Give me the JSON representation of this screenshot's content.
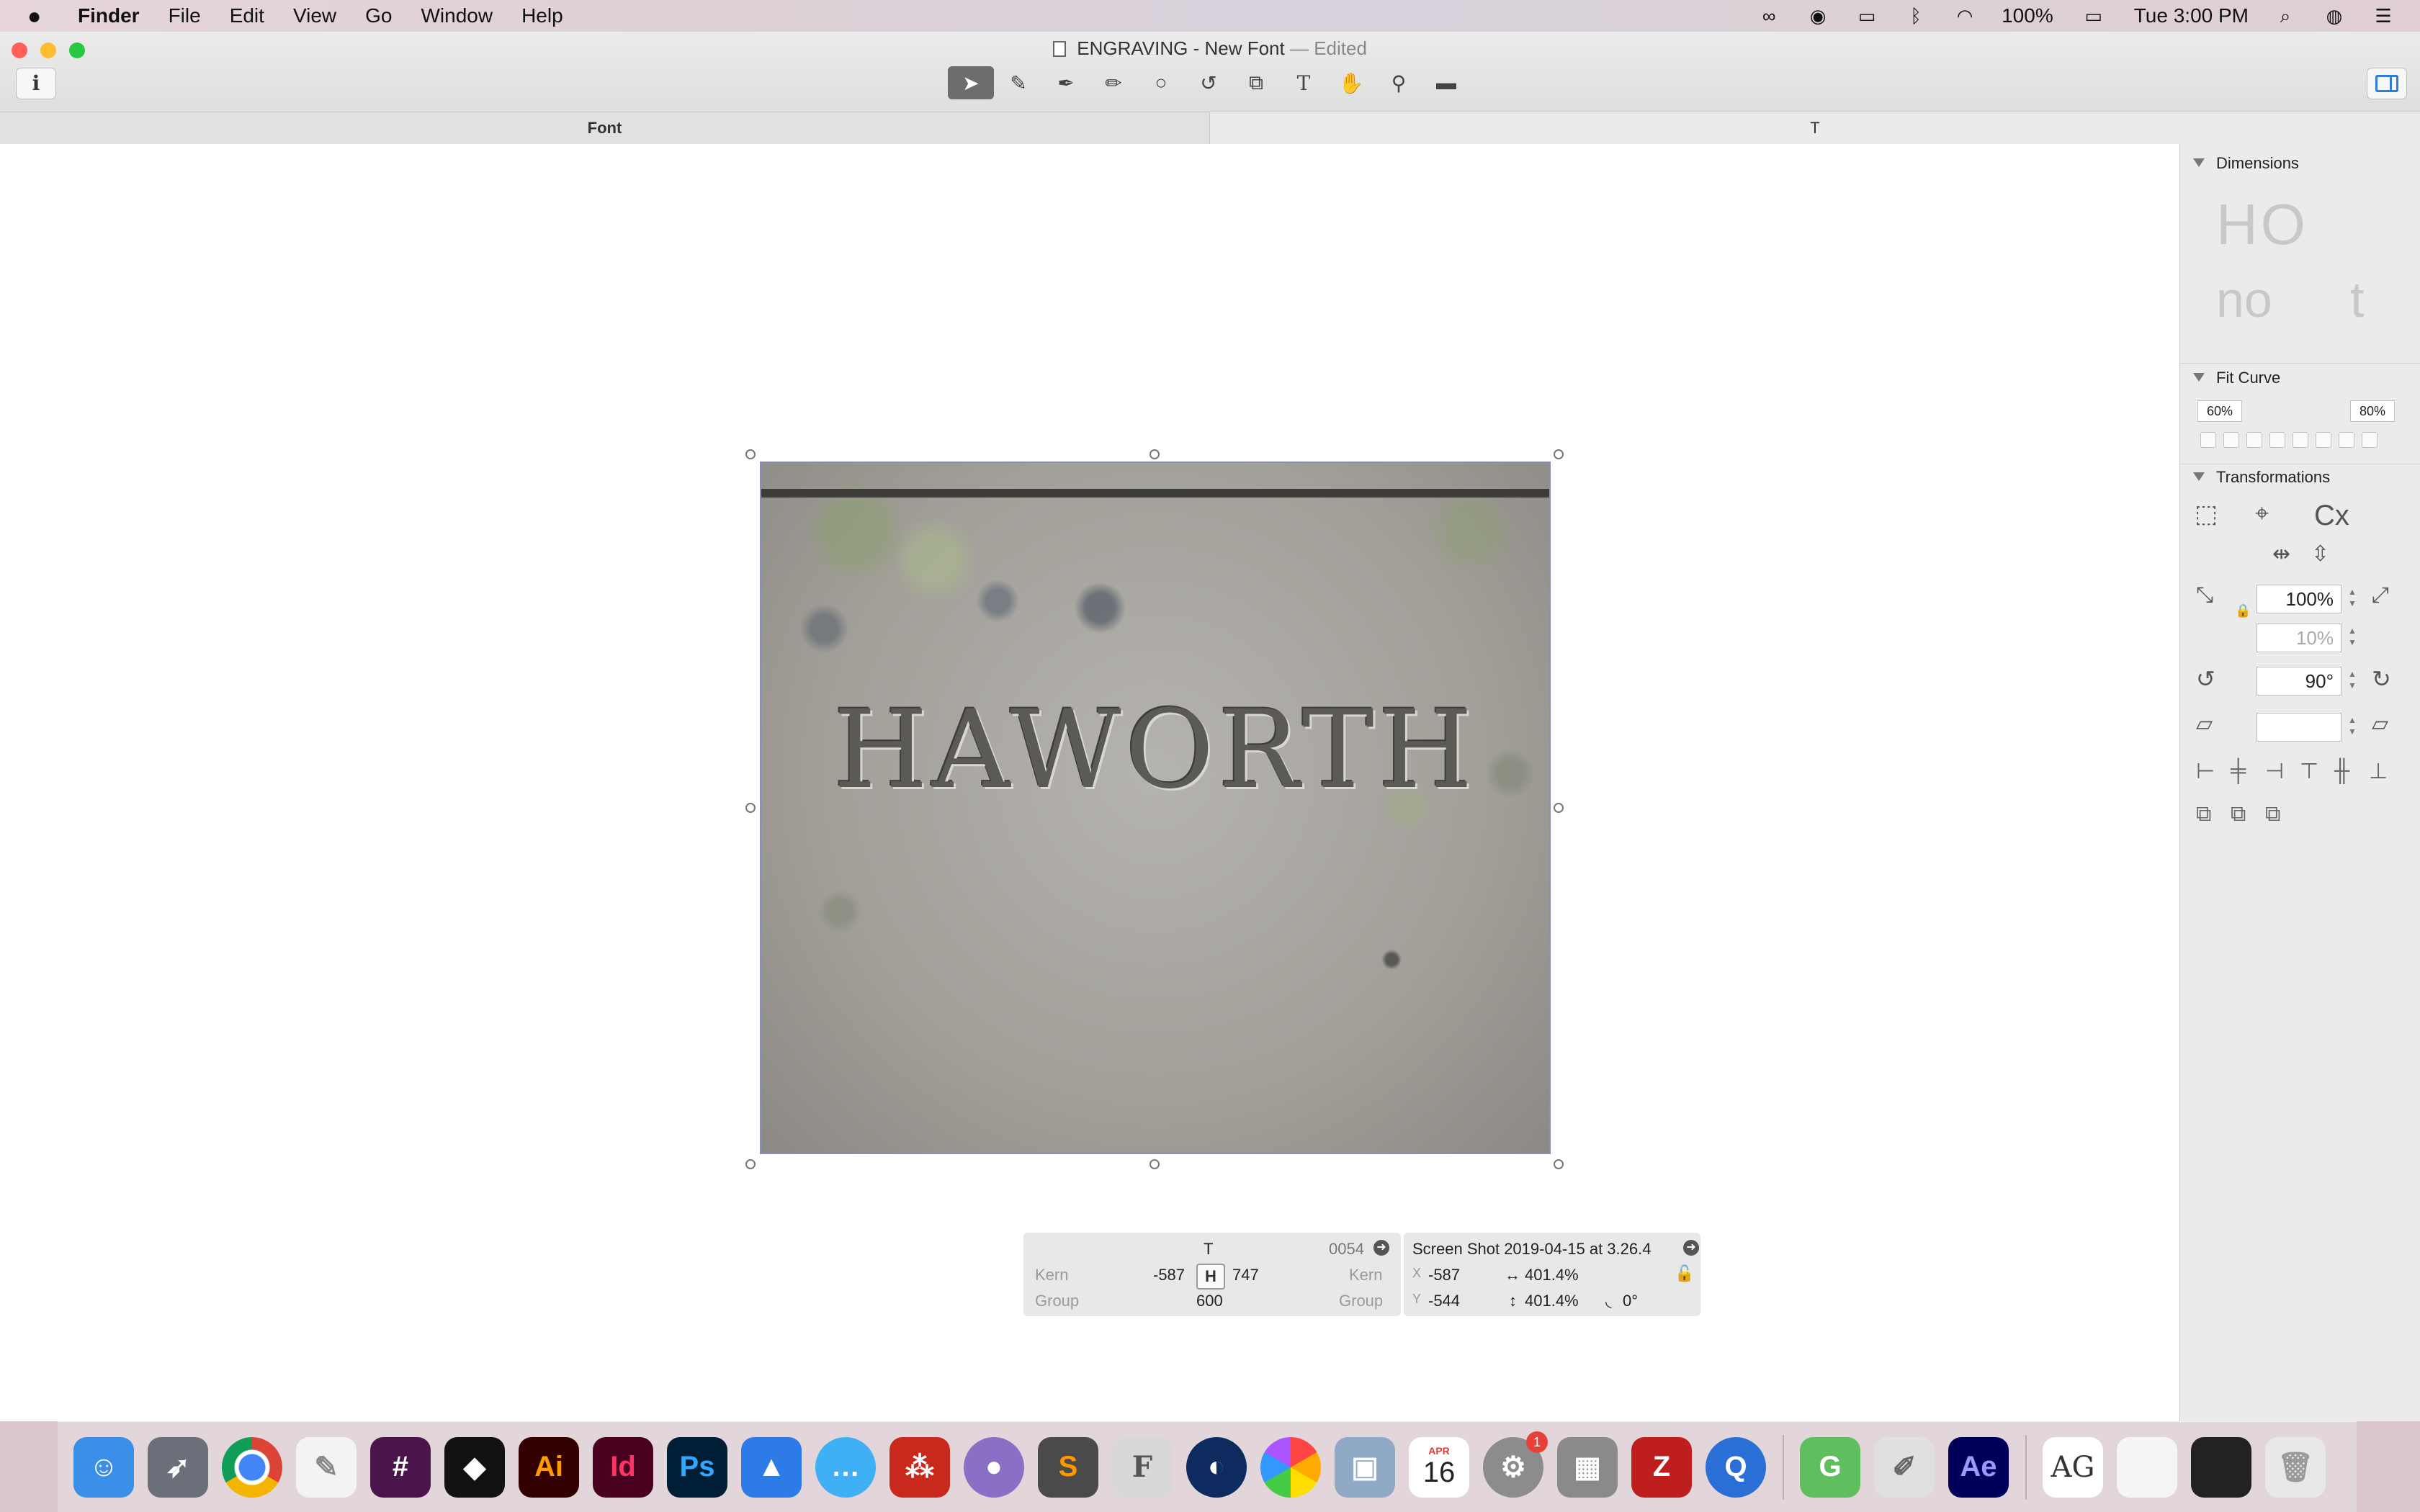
{
  "menubar": {
    "apple": "",
    "app": "Finder",
    "items": [
      "File",
      "Edit",
      "View",
      "Go",
      "Window",
      "Help"
    ],
    "battery": "100%",
    "clock": "Tue 3:00 PM"
  },
  "window": {
    "title": "ENGRAVING - New Font",
    "edited": "— Edited",
    "info_label": "i",
    "tools": [
      "pointer-tool",
      "draw-tool",
      "pen-tool",
      "pencil-tool",
      "shapes-tool",
      "rotate-tool",
      "scale-tool",
      "text-tool",
      "hand-tool",
      "zoom-tool",
      "measure-tool"
    ]
  },
  "tabs": {
    "font": "Font",
    "glyph": "T"
  },
  "canvas": {
    "engraving_text": "HAWORTH"
  },
  "info_panel": {
    "glyph_name": "T",
    "unicode": "0054",
    "kern_label": "Kern",
    "left_kern": "-587",
    "right_kern": "747",
    "kern_label_right": "Kern",
    "group_label": "Group",
    "width": "600",
    "group_label_right": "Group",
    "image_name": "Screen Shot 2019-04-15 at 3.26.4",
    "x_label": "X",
    "x_value": "-587",
    "y_label": "Y",
    "y_value": "-544",
    "scale_x": "401.4%",
    "scale_y": "401.4%",
    "rotation": "0°"
  },
  "inspector": {
    "dimensions_title": "Dimensions",
    "dim_sample_1": "HO",
    "dim_sample_2": "no",
    "dim_sample_3": "t",
    "fit_curve_title": "Fit Curve",
    "fit_min": "60%",
    "fit_max": "80%",
    "transformations_title": "Transformations",
    "scale_value": "100%",
    "scale_value_2": "10%",
    "rotate_value": "90°",
    "slant_value": ""
  },
  "dock": {
    "apps": [
      {
        "name": "finder",
        "label": "",
        "color": "#3c8fe8"
      },
      {
        "name": "launchpad",
        "label": "🚀",
        "color": "#6b6f7a"
      },
      {
        "name": "chrome",
        "label": "",
        "color": "#e8e8e8"
      },
      {
        "name": "textedit",
        "label": "",
        "color": "#f3f3f3"
      },
      {
        "name": "slack",
        "label": "#",
        "color": "#4a154b"
      },
      {
        "name": "tidal",
        "label": "◆",
        "color": "#111111"
      },
      {
        "name": "illustrator",
        "label": "Ai",
        "color": "#330000"
      },
      {
        "name": "indesign",
        "label": "Id",
        "color": "#49021f"
      },
      {
        "name": "photoshop",
        "label": "Ps",
        "color": "#001e36"
      },
      {
        "name": "keynote",
        "label": "",
        "color": "#2d7be6"
      },
      {
        "name": "messages",
        "label": "💬",
        "color": "#3fb0f6"
      },
      {
        "name": "acrobat",
        "label": "",
        "color": "#c9291c"
      },
      {
        "name": "github",
        "label": "",
        "color": "#8a6fc6"
      },
      {
        "name": "sublime",
        "label": "S",
        "color": "#4a4a4a"
      },
      {
        "name": "fontlab",
        "label": "F",
        "color": "#d8d8d8"
      },
      {
        "name": "cinema4d",
        "label": "",
        "color": "#0d2b5e"
      },
      {
        "name": "photos",
        "label": "",
        "color": "#f2f2f2"
      },
      {
        "name": "preview",
        "label": "",
        "color": "#8fa9c7"
      },
      {
        "name": "calendar",
        "label": "16",
        "color": "#ffffff"
      },
      {
        "name": "system-preferences",
        "label": "⚙",
        "color": "#8c8c8c"
      },
      {
        "name": "calculator",
        "label": "",
        "color": "#8a8a8a"
      },
      {
        "name": "filezilla",
        "label": "Z",
        "color": "#bf1e1e"
      },
      {
        "name": "quicktime",
        "label": "Q",
        "color": "#2a6fd6"
      },
      {
        "name": "glyphs",
        "label": "G",
        "color": "#5fbf5f"
      },
      {
        "name": "font-book",
        "label": "",
        "color": "#e0e0e0"
      },
      {
        "name": "after-effects",
        "label": "Ae",
        "color": "#00005b"
      }
    ],
    "calendar_month": "APR",
    "calendar_day": "16",
    "sysprefs_badge": "1",
    "stack_label": "AG"
  }
}
